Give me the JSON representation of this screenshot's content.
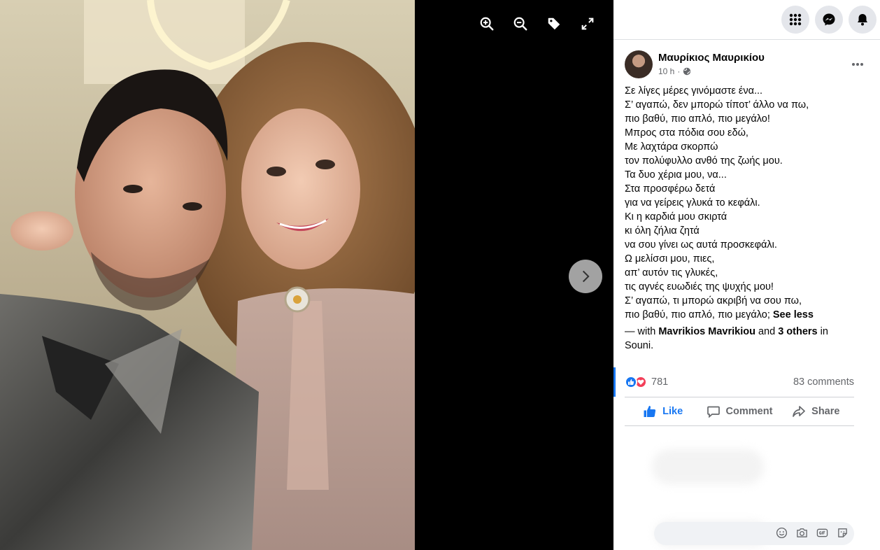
{
  "viewer": {
    "toolbar": [
      {
        "name": "zoom-in-icon"
      },
      {
        "name": "zoom-out-icon"
      },
      {
        "name": "tag-icon"
      },
      {
        "name": "fullscreen-icon"
      }
    ],
    "next_icon": "chevron-right-icon"
  },
  "topbar": {
    "icons": [
      "menu-grid-icon",
      "messenger-icon",
      "notifications-bell-icon"
    ]
  },
  "post": {
    "author": "Μαυρίκιος Μαυρικίου",
    "time": "10 h",
    "privacy_icon": "globe-icon",
    "caption_lines": [
      "Σε λίγες μέρες γινόμαστε ένα...",
      "Σ’ αγαπώ, δεν μπορώ τίποτ’ άλλο να πω,",
      "πιο βαθύ, πιο απλό, πιο μεγάλο!",
      "Μπρος στα πόδια σου εδώ,",
      "Με λαχτάρα σκορπώ",
      "τον πολύφυλλο ανθό της ζωής μου.",
      "Τα δυο χέρια μου, να...",
      "Στα προσφέρω δετά",
      "για να γείρεις γλυκά το κεφάλι.",
      "Κι η καρδιά μου σκιρτά",
      "κι όλη ζήλια ζητά",
      "να σου γίνει ως αυτά προσκεφάλι.",
      "Ω μελίσσι μου, πιες,",
      "απ’ αυτόν τις γλυκές,",
      "τις αγνές ευωδιές της ψυχής μου!",
      "Σ’ αγαπώ, τι μπορώ ακριβή να σου πω,",
      "πιο βαθύ, πιο απλό, πιο μεγάλο;"
    ],
    "see_less": "See less",
    "tag_prefix": "— with ",
    "tag_person": "Mavrikios Mavrikiou",
    "tag_and": " and ",
    "tag_others": "3 others",
    "tag_in": " in ",
    "tag_place": "Souni",
    "tag_end": "."
  },
  "stats": {
    "reaction_count": "781",
    "comments": "83 comments",
    "reaction_icons": [
      "like-reaction-icon",
      "love-reaction-icon"
    ]
  },
  "actions": {
    "like": "Like",
    "comment": "Comment",
    "share": "Share"
  },
  "composer": {
    "icons": [
      "emoji-icon",
      "camera-icon",
      "gif-icon",
      "sticker-icon"
    ]
  },
  "colors": {
    "accent": "#1877f2",
    "love": "#f33e58",
    "secondary_text": "#65676b",
    "divider": "#ced0d4"
  }
}
